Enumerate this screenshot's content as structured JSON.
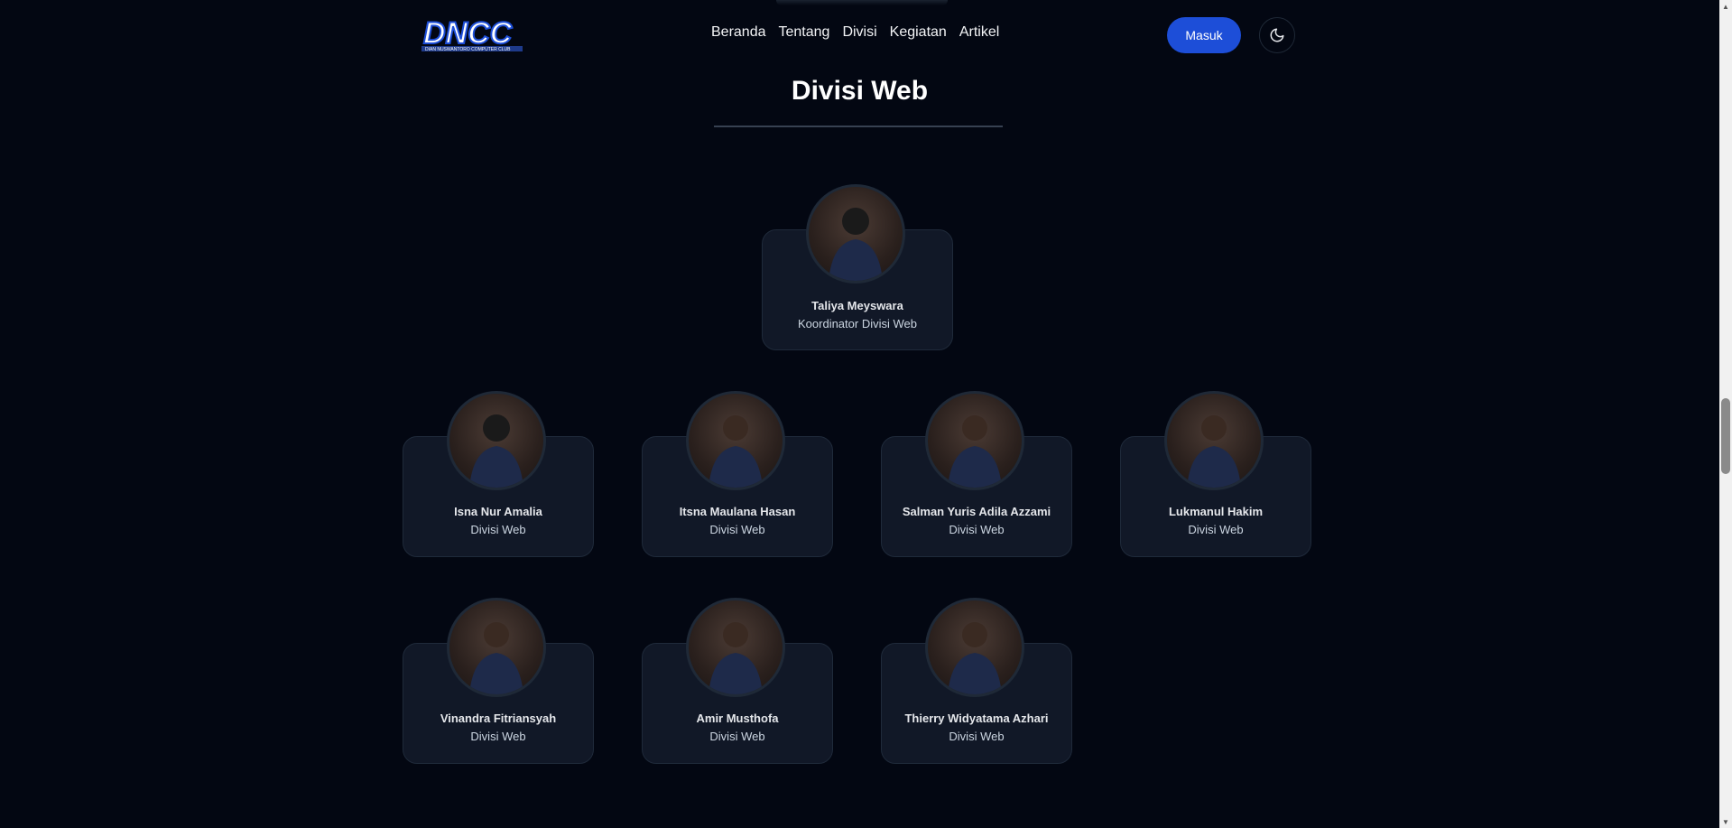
{
  "header": {
    "logo_text": "DNCC",
    "logo_subtext": "DIAN NUSWANTORO COMPUTER CLUB",
    "nav": [
      "Beranda",
      "Tentang",
      "Divisi",
      "Kegiatan",
      "Artikel"
    ],
    "login_label": "Masuk",
    "theme_icon": "moon-icon"
  },
  "section": {
    "title": "Divisi Web"
  },
  "coordinator": {
    "name": "Taliya Meyswara",
    "role": "Koordinator Divisi Web"
  },
  "members": [
    {
      "name": "Isna Nur Amalia",
      "role": "Divisi Web"
    },
    {
      "name": "Itsna Maulana Hasan",
      "role": "Divisi Web"
    },
    {
      "name": "Salman Yuris Adila Azzami",
      "role": "Divisi Web"
    },
    {
      "name": "Lukmanul Hakim",
      "role": "Divisi Web"
    },
    {
      "name": "Vinandra Fitriansyah",
      "role": "Divisi Web"
    },
    {
      "name": "Amir Musthofa",
      "role": "Divisi Web"
    },
    {
      "name": "Thierry Widyatama Azhari",
      "role": "Divisi Web"
    }
  ],
  "colors": {
    "background": "#030712",
    "card": "#111827",
    "accent": "#1d4ed8"
  }
}
